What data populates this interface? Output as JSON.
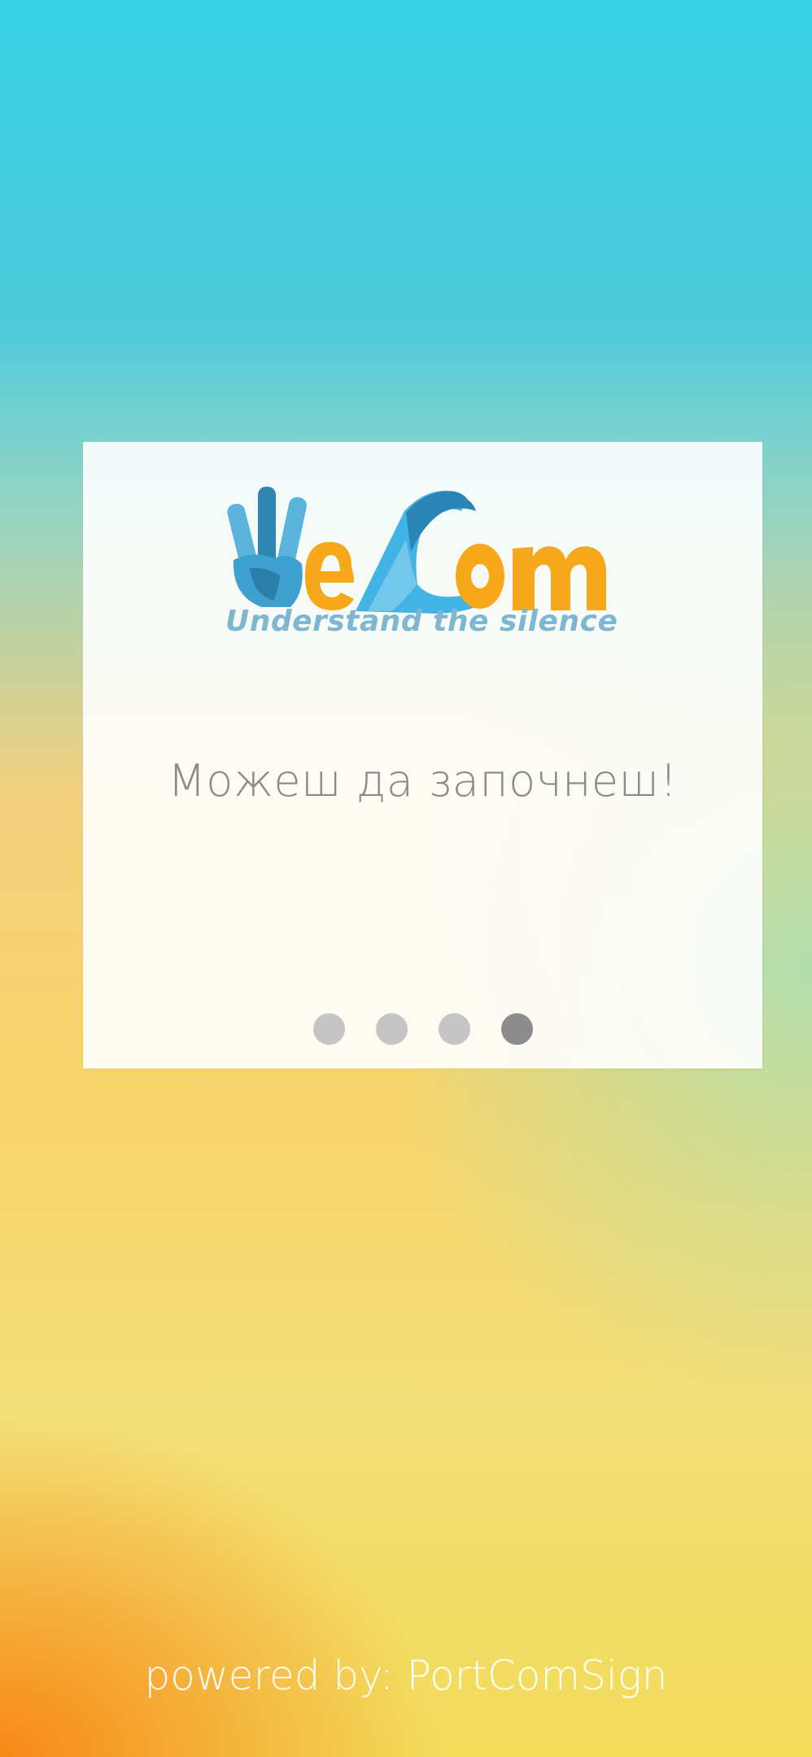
{
  "app": {
    "logo_text": "WeCom",
    "tagline": "Understand the silence",
    "colors": {
      "logo_blue": "#3a9fcf",
      "logo_orange": "#f6a81a",
      "tagline": "#7fb6d1",
      "dot_inactive": "#c5c5c5",
      "dot_active": "#8c8c8c"
    }
  },
  "onboarding": {
    "headline": "Можеш да започнеш!",
    "pager": {
      "total_pages": 4,
      "current_page": 4
    }
  },
  "footer": {
    "powered_by": "powered by: PortComSign"
  }
}
